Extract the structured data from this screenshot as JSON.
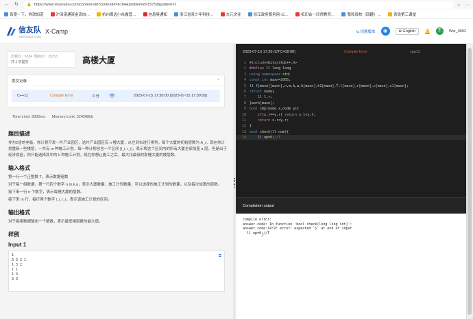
{
  "browser": {
    "url": "https://www.xinyoudui.com/contest-old?contestId=6184&problemId=15753&pattern=1",
    "bookmarks": [
      "百度一下，你就知道",
      "沪深港通资金流向…",
      "杭州周边小众露营…",
      "信息奥通知",
      "浙江省青少年科技…",
      "大元文化",
      "浙江政务服务网-公…",
      "拓印会一印师教育…",
      "我和母校（四趣）…",
      "青铁第三课堂"
    ]
  },
  "header": {
    "logo_text": "信友队",
    "logo_sub": "XINYOUDUI.COM",
    "xcamp": "X·Camp",
    "switch_version": "切换版本",
    "language": "English",
    "user_initial": "王",
    "username": "Wsr_0902"
  },
  "problem": {
    "contest_label": "比赛ID：",
    "contest_id": "6184",
    "problem_label": "题目ID：",
    "problem_id": "15753",
    "submit_count": "共 1 次提交",
    "title": "高楼大厦"
  },
  "submissions": {
    "tab_label": "提交记录",
    "row": {
      "lang": "C++11",
      "status": "Compile Error",
      "score": "0 分",
      "time": "2023-07-15 17:30:00 (2023-07-15 17:30:00)"
    }
  },
  "limits": {
    "time": "Time Limit:  3000ms",
    "memory": "Memory Limit:  524288kb"
  },
  "sections": {
    "desc_title": "题目描述",
    "desc_text": "作为Z省的老板，你计划开发一片产业园区，这片产业园区有 n 幢大厦，从左到右进行排列，每个大厦的初始层数为 A_i。现在你计划重新一些楼层，一共有 m 种施工计划，每一种计划包含一个区间 [l_i, r_i]，表示将这个区间内的所有大厦全部加盖 a 层。但是出于经济原因，你只能选择其中的 k 种施工计划，现在你想让施工之后，最大化最低的那幢大厦的楼层数。",
    "input_title": "输入格式",
    "input_p1": "第一行一个正整数 T，表示数据组数",
    "input_p2": "对于每一组数据，第一行四个数字 n,m,k,a，表示大厦数量，施工计划数量，可以选择的施工计划的数量，以及每次加盖的层数。",
    "input_p3": "接下来一行 n 个数字，表示每幢大厦的层数。",
    "input_p4": "接下来 m 行，每行两个数字 l_i, r_i，表示该施工计划的区间。",
    "output_title": "输出格式",
    "output_p1": "对于每组数据输出一个整数，表示最低楼层数的最大值。",
    "sample_title": "样例",
    "input1_title": "Input 1",
    "sample_input": "1\n3 3 2 1\n1 3 2\n1 1\n1 3\n3 3"
  },
  "editor": {
    "timestamp": "2023-07-15 17:30 (UTC+08:00)",
    "status": "Compile Error",
    "lang": "cpp11"
  },
  "output": {
    "title": "Compilation output",
    "text": "compile error:\nanswer.code: In function 'bool check(long long int)':\nanswer.code:14:9: error: expected '}' at end of input\n  ll op=0;//T\n         ^"
  }
}
